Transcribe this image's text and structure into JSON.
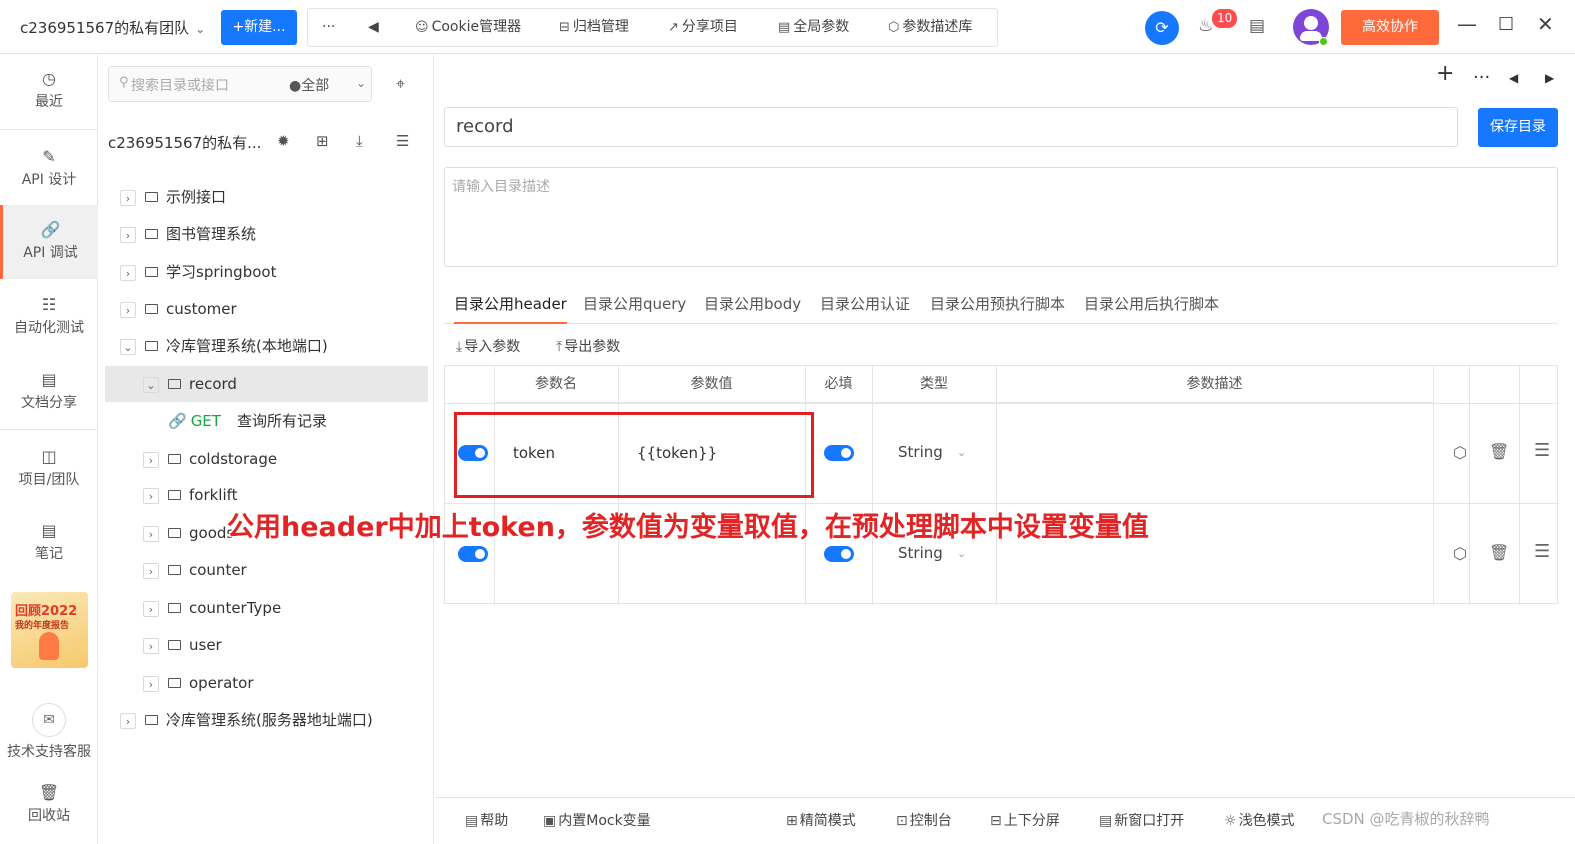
{
  "topbar": {
    "team": "c236951567的私有团队",
    "new_label": "+新建...",
    "more": "···",
    "tools": [
      {
        "label": "Cookie管理器",
        "icon": "cookie-icon"
      },
      {
        "label": "归档管理",
        "icon": "archive-icon"
      },
      {
        "label": "分享项目",
        "icon": "share-icon"
      },
      {
        "label": "全局参数",
        "icon": "global-params-icon"
      },
      {
        "label": "参数描述库",
        "icon": "cube-icon"
      }
    ],
    "notifications": "10",
    "collab_label": "高效协作"
  },
  "rail": {
    "items": [
      {
        "label": "最近",
        "icon": "clock-icon"
      },
      {
        "label": "API 设计",
        "icon": "edit-icon"
      },
      {
        "label": "API 调试",
        "icon": "link-icon"
      },
      {
        "label": "自动化测试",
        "icon": "flow-icon"
      },
      {
        "label": "文档分享",
        "icon": "doc-icon"
      },
      {
        "label": "项目/团队",
        "icon": "folder-icon"
      },
      {
        "label": "笔记",
        "icon": "note-icon"
      },
      {
        "label": "技术支持客服",
        "icon": "support-icon"
      },
      {
        "label": "回收站",
        "icon": "trash-icon"
      }
    ],
    "report_title": "回顾2022",
    "report_sub": "我的年度报告"
  },
  "tree": {
    "search_placeholder": "搜索目录或接口",
    "scope": "全部",
    "project": "c236951567的私有...",
    "nodes": [
      {
        "label": "示例接口"
      },
      {
        "label": "图书管理系统"
      },
      {
        "label": "学习springboot"
      },
      {
        "label": "customer"
      },
      {
        "label": "冷库管理系统(本地端口)"
      },
      {
        "label": "record"
      },
      {
        "method": "GET",
        "label": "查询所有记录"
      },
      {
        "label": "coldstorage"
      },
      {
        "label": "forklift"
      },
      {
        "label": "goods"
      },
      {
        "label": "counter"
      },
      {
        "label": "counterType"
      },
      {
        "label": "user"
      },
      {
        "label": "operator"
      },
      {
        "label": "冷库管理系统(服务器地址端口)"
      }
    ]
  },
  "main": {
    "name_value": "record",
    "save_label": "保存目录",
    "desc_placeholder": "请输入目录描述",
    "tabs": [
      "目录公用header",
      "目录公用query",
      "目录公用body",
      "目录公用认证",
      "目录公用预执行脚本",
      "目录公用后执行脚本"
    ],
    "import_label": "导入参数",
    "export_label": "导出参数",
    "columns": [
      "参数名",
      "参数值",
      "必填",
      "类型",
      "参数描述"
    ],
    "rows": [
      {
        "name": "token",
        "value": "{{token}}",
        "required": true,
        "type": "String",
        "desc": ""
      },
      {
        "name": "",
        "value": "",
        "required": true,
        "type": "String",
        "desc": ""
      }
    ],
    "annotation": "公用header中加上token，参数值为变量取值，在预处理脚本中设置变量值"
  },
  "bottombar": {
    "items": [
      "帮助",
      "内置Mock变量",
      "精简模式",
      "控制台",
      "上下分屏",
      "新窗口打开",
      "浅色模式"
    ],
    "watermark": "CSDN @吃青椒的秋辞鸭"
  }
}
